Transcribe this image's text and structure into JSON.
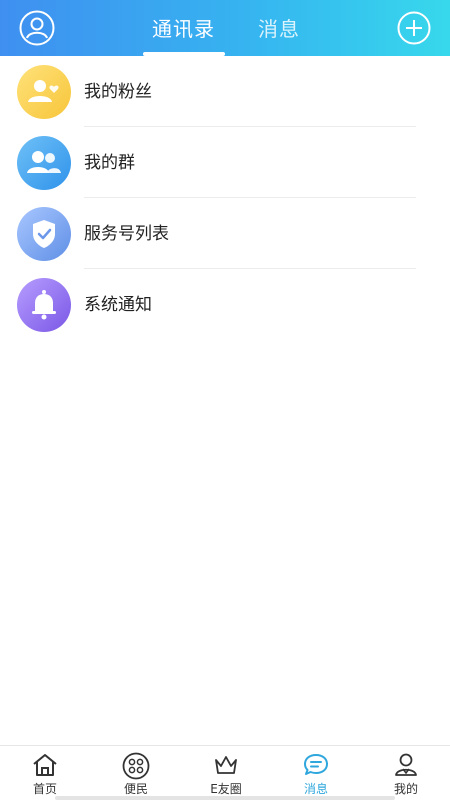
{
  "header": {
    "tabs": [
      {
        "label": "通讯录",
        "active": true
      },
      {
        "label": "消息",
        "active": false
      }
    ],
    "left_icon": "user-avatar-icon",
    "right_icon": "add-circle-icon",
    "gradient_colors": [
      "#3f8ff0",
      "#37d8ec"
    ]
  },
  "list": {
    "items": [
      {
        "label": "我的粉丝",
        "icon": "fans-icon",
        "color": "#f7c53a"
      },
      {
        "label": "我的群",
        "icon": "group-icon",
        "color": "#2f92ea"
      },
      {
        "label": "服务号列表",
        "icon": "shield-check-icon",
        "color": "#5f8fe6"
      },
      {
        "label": "系统通知",
        "icon": "bell-icon",
        "color": "#7a57e6"
      }
    ]
  },
  "bottom_nav": {
    "items": [
      {
        "label": "首页",
        "icon": "home-icon",
        "active": false
      },
      {
        "label": "便民",
        "icon": "grid-circle-icon",
        "active": false
      },
      {
        "label": "E友圈",
        "icon": "crown-icon",
        "active": false
      },
      {
        "label": "消息",
        "icon": "chat-bubble-icon",
        "active": true
      },
      {
        "label": "我的",
        "icon": "profile-icon",
        "active": false
      }
    ],
    "active_color": "#2fa7dd"
  }
}
